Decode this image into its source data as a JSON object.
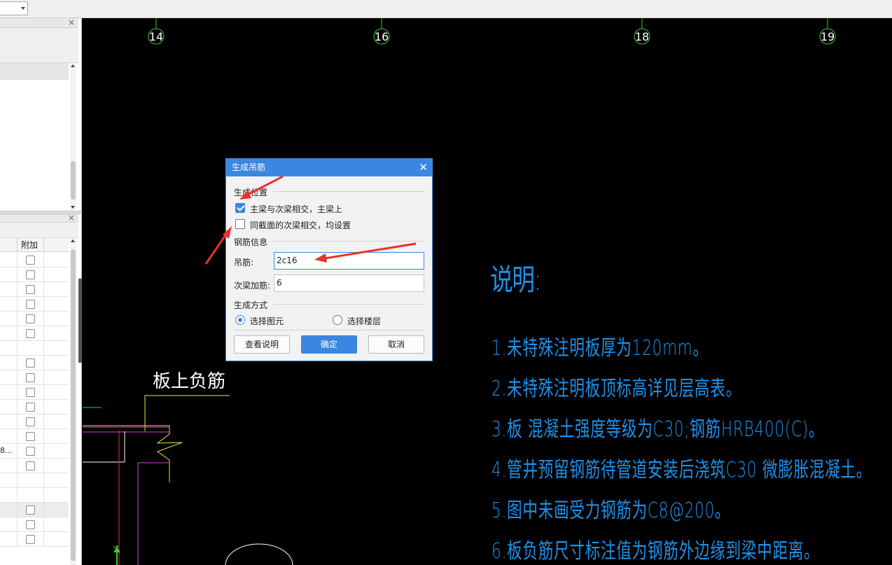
{
  "dialog": {
    "title": "生成吊筋",
    "close_icon": "✕",
    "section_position": "生成位置",
    "checkbox_main_secondary": {
      "label": "主梁与次梁相交，主梁上",
      "checked": true
    },
    "checkbox_same_section": {
      "label": "同截面的次梁相交，均设置",
      "checked": false
    },
    "section_rebar": "钢筋信息",
    "hanger_label": "吊筋:",
    "hanger_value": "2c16",
    "extra_label": "次梁加筋:",
    "extra_value": "6",
    "section_method": "生成方式",
    "radio_select_elements": {
      "label": "选择图元",
      "selected": true
    },
    "radio_select_floors": {
      "label": "选择楼层",
      "selected": false
    },
    "btn_help": "查看说明",
    "btn_ok": "确定",
    "btn_cancel": "取消"
  },
  "left_panel": {
    "panel_close_icon": "×",
    "column_header": "附加",
    "truncated_cell": "8..."
  },
  "cad": {
    "axis_labels": [
      "14",
      "16",
      "18",
      "19"
    ],
    "slab_label": "板上负筋",
    "y_axis_label": "Y",
    "notes_title": "说明:",
    "notes": [
      "1.未特殊注明板厚为120mm。",
      "2.未特殊注明板顶标高详见层高表。",
      "3.板 混凝土强度等级为C30;钢筋HRB400(C)。",
      "4.管井预留钢筋待管道安装后浇筑C30 微膨胀混凝土。",
      "5.图中未画受力钢筋为C8@200。",
      "6.板负筋尺寸标注值为钢筋外边缘到梁中距离。"
    ]
  },
  "colors": {
    "accent": "#3a86e0",
    "annotation_arrow": "#e8322a",
    "notes_text": "#1e90e8"
  }
}
